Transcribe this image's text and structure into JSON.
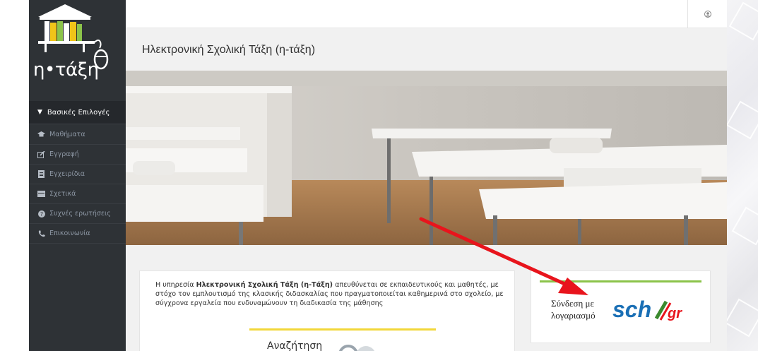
{
  "app": {
    "logo_text": "η•τάξη"
  },
  "sidebar": {
    "section_label": "Βασικές Επιλογές",
    "items": [
      {
        "label": "Μαθήματα",
        "icon": "graduation-cap-icon"
      },
      {
        "label": "Εγγραφή",
        "icon": "edit-icon"
      },
      {
        "label": "Εγχειρίδια",
        "icon": "document-icon"
      },
      {
        "label": "Σχετικά",
        "icon": "card-icon"
      },
      {
        "label": "Συχνές ερωτήσεις",
        "icon": "question-circle-icon"
      },
      {
        "label": "Επικοινωνία",
        "icon": "phone-icon"
      }
    ]
  },
  "topbar": {
    "user_icon": "user-icon"
  },
  "main": {
    "page_title": "Ηλεκτρονική Σχολική Τάξη (η-τάξη)",
    "intro": {
      "text_before": "Η υπηρεσία ",
      "text_bold": "Ηλεκτρονική Σχολική Τάξη (η-Τάξη)",
      "text_after": " απευθύνεται σε εκπαιδευτικούς και μαθητές, με στόχο τον εμπλουτισμό της κλασικής διδασκαλίας που πραγματοποιείται καθημερινά στο σχολείο, με σύγχρονα εργαλεία που ενδυναμώνουν τη διαδικασία της μάθησης",
      "search_label": "Αναζήτηση"
    },
    "login": {
      "label": "Σύνδεση με λογαριασμό",
      "logo_text": "sch",
      "logo_suffix": "gr"
    }
  },
  "colors": {
    "sidebar_bg": "#2e3236",
    "accent_yellow": "#f2d73a",
    "accent_green": "#8bc34a",
    "arrow_red": "#e8141c",
    "sch_blue": "#1a6fb5"
  }
}
